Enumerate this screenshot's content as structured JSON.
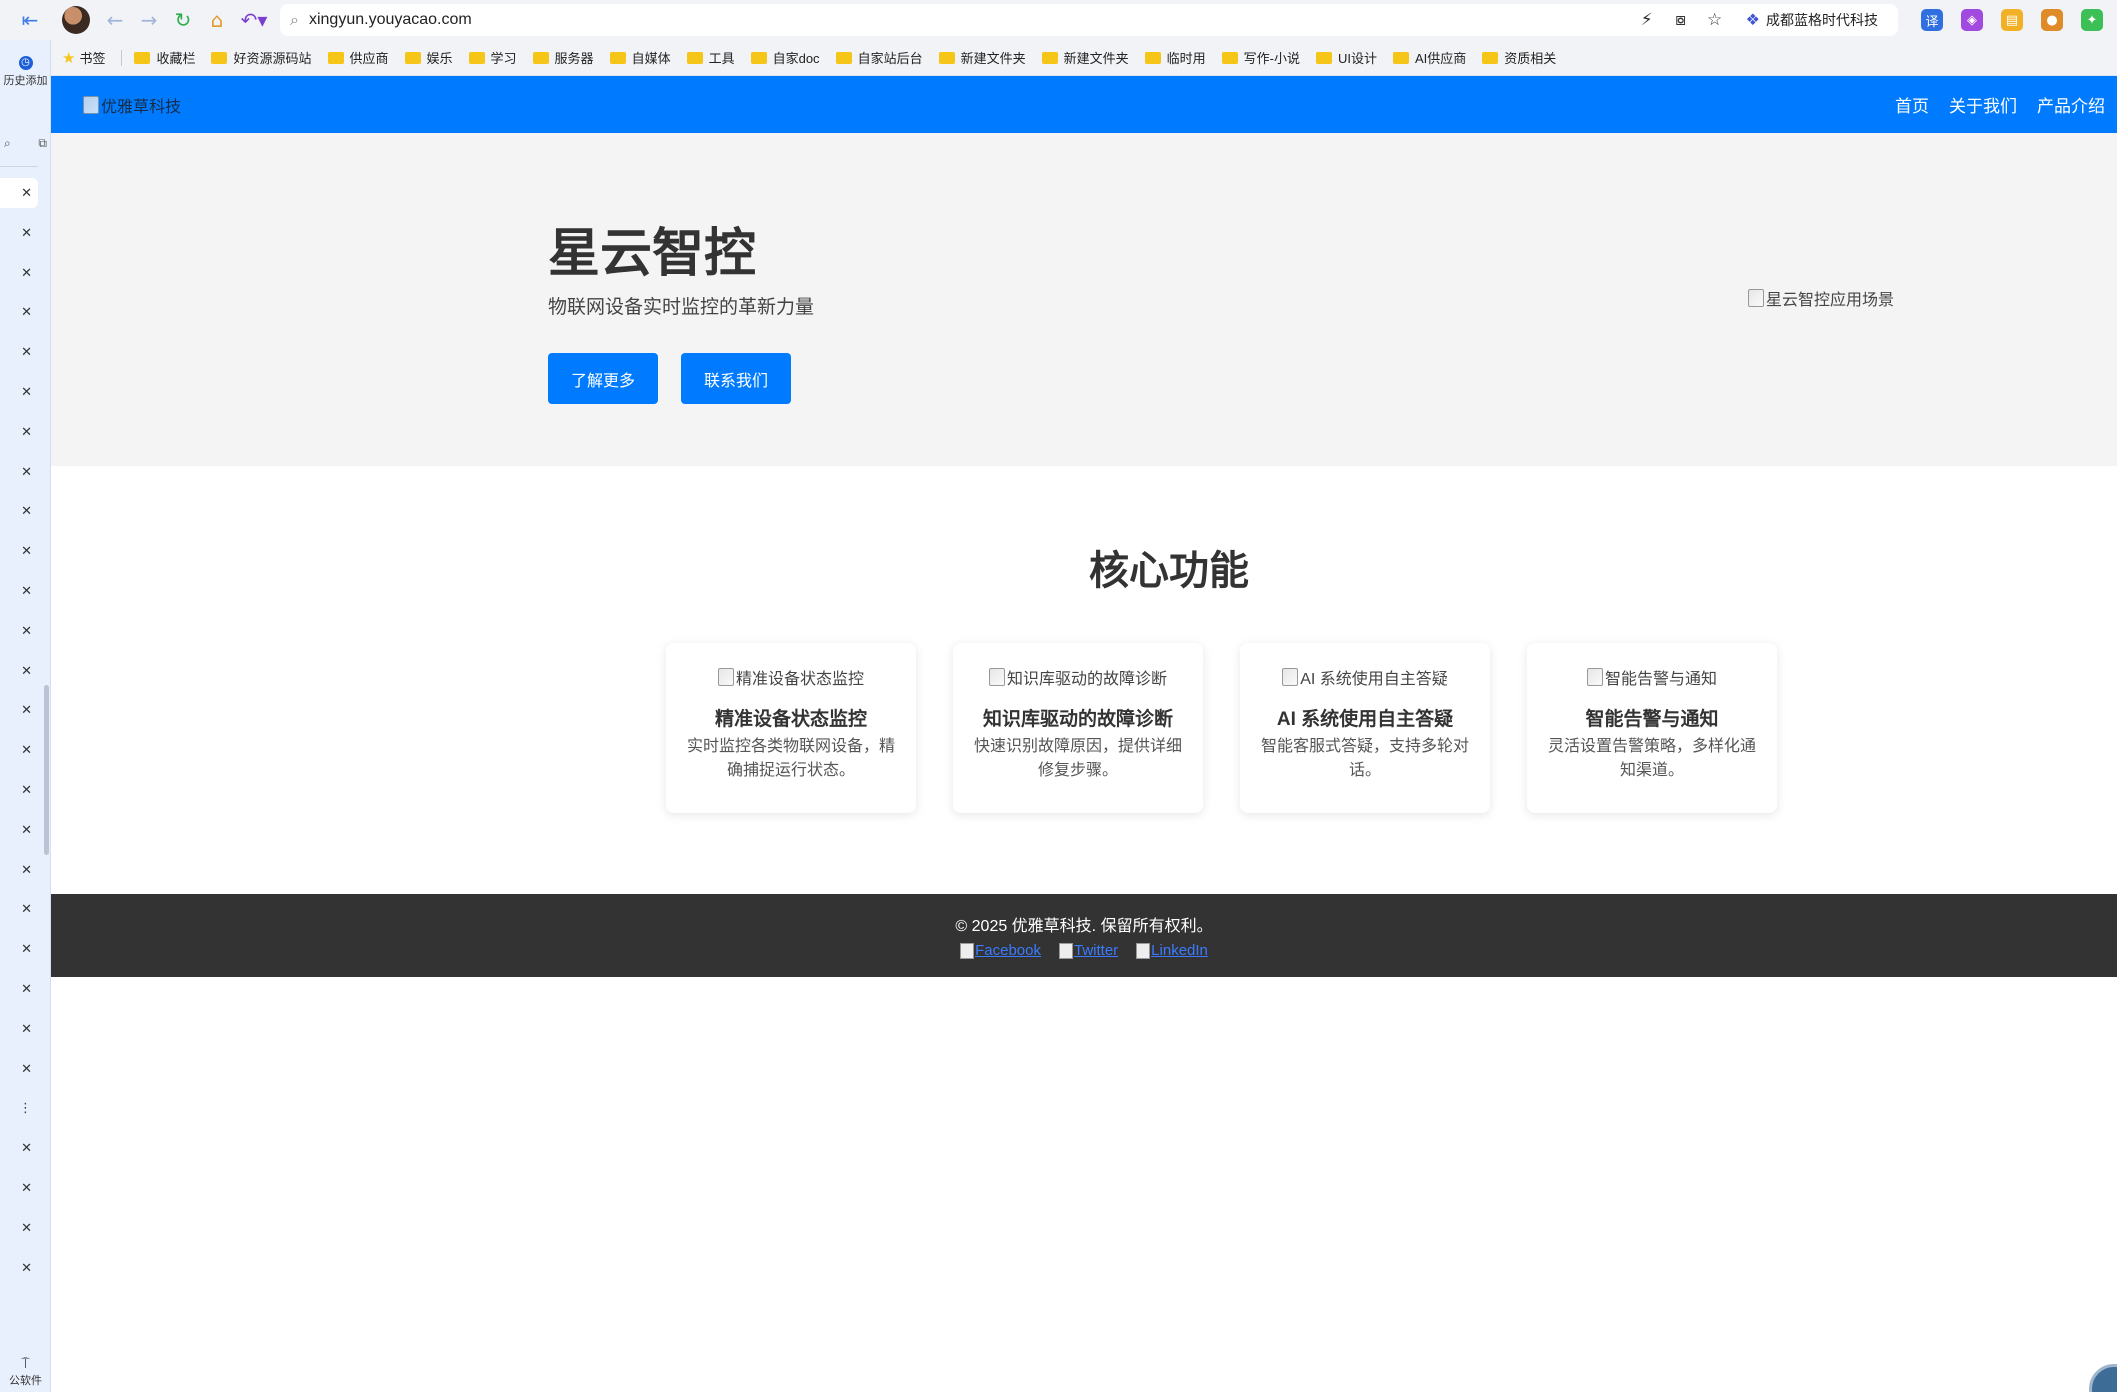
{
  "browser": {
    "url": "xingyun.youyacao.com",
    "profile_label": "成都蓝格时代科技",
    "bookmarks_title": "书签",
    "bookmarks": [
      "收藏栏",
      "好资源源码站",
      "供应商",
      "娱乐",
      "学习",
      "服务器",
      "自媒体",
      "工具",
      "自家doc",
      "自家站后台",
      "新建文件夹",
      "新建文件夹",
      "临时用",
      "写作-小说",
      "UI设计",
      "AI供应商",
      "资质相关"
    ],
    "sidebar_history_label": "历史添加",
    "sidebar_bottom_label": "公软件"
  },
  "site": {
    "logo_alt": "优雅草科技",
    "nav": [
      "首页",
      "关于我们",
      "产品介绍"
    ],
    "hero": {
      "title": "星云智控",
      "subtitle": "物联网设备实时监控的革新力量",
      "btn_more": "了解更多",
      "btn_contact": "联系我们",
      "image_alt": "星云智控应用场景"
    },
    "features": {
      "title": "核心功能",
      "cards": [
        {
          "img_alt": "精准设备状态监控",
          "title": "精准设备状态监控",
          "desc": "实时监控各类物联网设备，精确捕捉运行状态。"
        },
        {
          "img_alt": "知识库驱动的故障诊断",
          "title": "知识库驱动的故障诊断",
          "desc": "快速识别故障原因，提供详细修复步骤。"
        },
        {
          "img_alt": "AI 系统使用自主答疑",
          "title": "AI 系统使用自主答疑",
          "desc": "智能客服式答疑，支持多轮对话。"
        },
        {
          "img_alt": "智能告警与通知",
          "title": "智能告警与通知",
          "desc": "灵活设置告警策略，多样化通知渠道。"
        }
      ]
    },
    "footer": {
      "copyright": "© 2025 优雅草科技. 保留所有权利。",
      "social": [
        "Facebook",
        "Twitter",
        "LinkedIn"
      ]
    }
  },
  "colors": {
    "brand_blue": "#007bff",
    "hero_bg": "#f4f4f4",
    "footer_bg": "#333333"
  }
}
